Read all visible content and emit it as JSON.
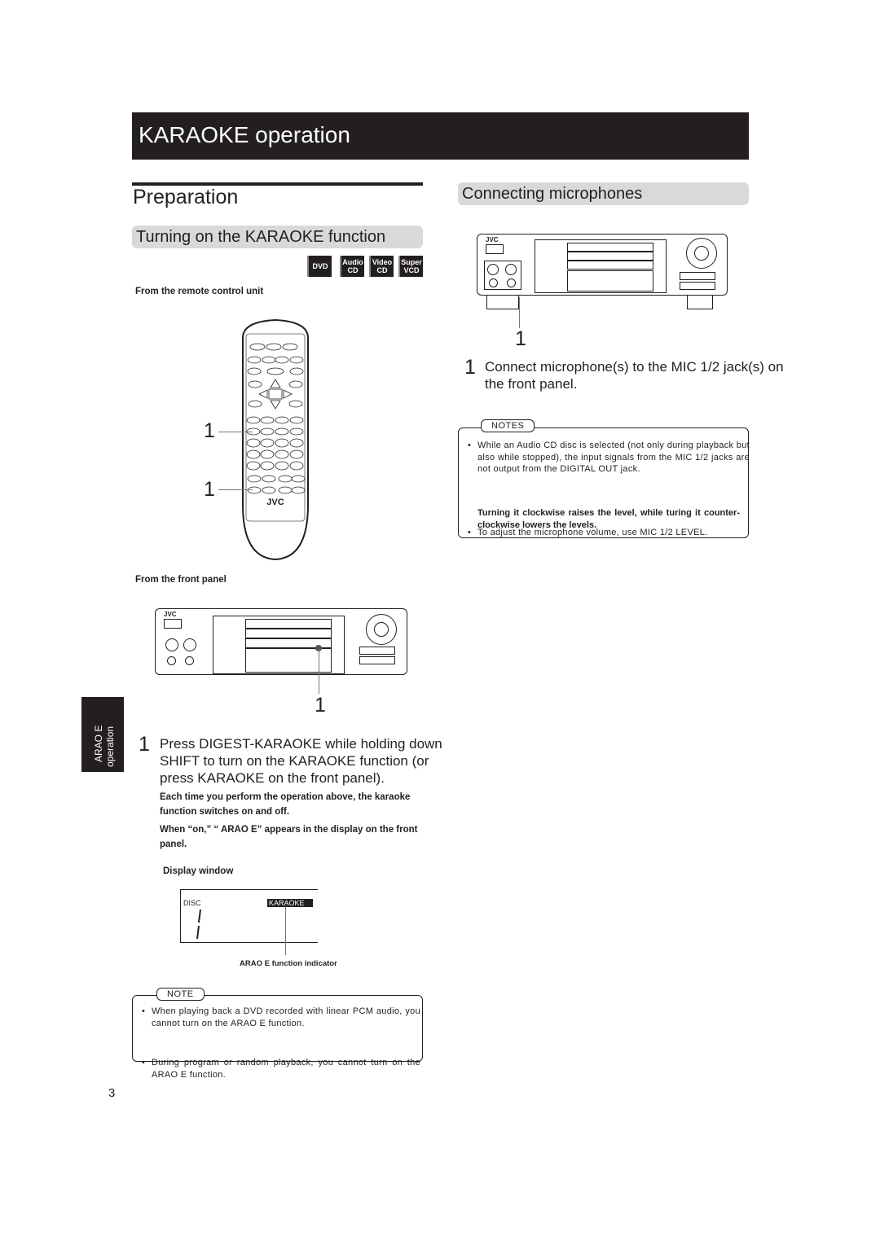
{
  "header": {
    "title": "KARAOKE operation"
  },
  "preparation": {
    "title": "Preparation",
    "section_turning_on": {
      "title": "Turning on the KARAOKE function",
      "disc_badges": [
        {
          "line1": "DVD",
          "line2": ""
        },
        {
          "line1": "Audio",
          "line2": "CD"
        },
        {
          "line1": "Video",
          "line2": "CD"
        },
        {
          "line1": "Super",
          "line2": "VCD"
        }
      ],
      "remote_label": "From the remote control unit",
      "remote_brand": "JVC",
      "remote_callouts": [
        "1",
        "1"
      ],
      "front_panel_label": "From the front panel",
      "front_panel_callout": "1",
      "step": {
        "number": "1",
        "text": "Press DIGEST-KARAOKE while holding down SHIFT to turn on the KARAOKE function (or press KARAOKE on the front panel).",
        "detail1": "Each time you perform the operation above, the karaoke function switches on and off.",
        "detail2": "When “on,” “  ARAO  E” appears in the display on the front panel."
      },
      "display_window": {
        "label": "Display window",
        "disc_text": "DISC",
        "indicator_text": "KARAOKE",
        "digit": "1",
        "caption": "ARAO  E function indicator"
      },
      "note": {
        "tab": "NOTE",
        "items": [
          "When playing back a DVD recorded with linear PCM audio, you cannot turn on the   ARAO  E function.",
          "During program or random playback, you cannot turn on the   ARAO  E function."
        ]
      }
    }
  },
  "connecting": {
    "title": "Connecting microphones",
    "device_brand": "JVC",
    "callout": "1",
    "step": {
      "number": "1",
      "text": "Connect microphone(s) to the MIC 1/2 jack(s) on the front panel."
    },
    "notes": {
      "tab": "NOTES",
      "items": [
        "While an Audio CD disc is selected (not only during playback but also while stopped), the input signals from the MIC 1/2 jacks are not output from the DIGITAL OUT jack.",
        "To adjust the microphone volume, use MIC 1/2 LEVEL."
      ],
      "bold": "Turning it clockwise raises the level, while turing it counter-clockwise lowers the levels."
    }
  },
  "side_tab": {
    "line1": "ARAO  E",
    "line2": "operation"
  },
  "page_number": "3"
}
